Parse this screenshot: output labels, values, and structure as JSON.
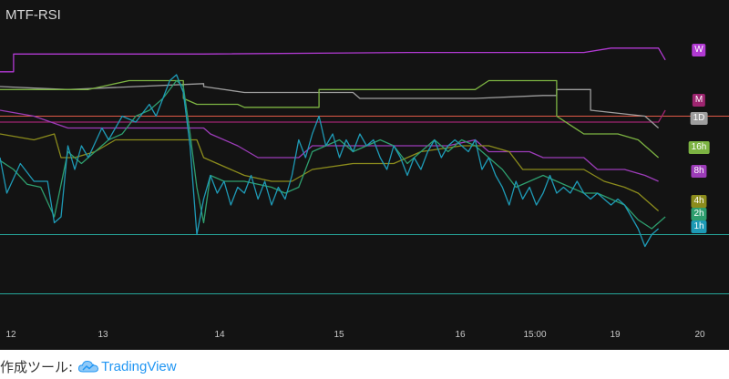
{
  "title": "MTF-RSI",
  "footer": {
    "prefix": "作成ツール:",
    "brand": "TradingView"
  },
  "colors": {
    "background": "#131313",
    "upper_line": "#e05a47",
    "lower_line": "#26a69a"
  },
  "chart_data": {
    "type": "line",
    "title": "MTF-RSI",
    "x_ticks": [
      "12",
      "13",
      "14",
      "15",
      "16",
      "15:00",
      "19",
      "20"
    ],
    "x_range": [
      0,
      100
    ],
    "y_range": [
      0,
      100
    ],
    "hlines": [
      {
        "value": 70,
        "color": "#e05a47"
      },
      {
        "value": 30,
        "color": "#26a69a"
      },
      {
        "value": 10,
        "color": "#26a69a"
      }
    ],
    "series": [
      {
        "name": "W",
        "color": "#b23ad3",
        "points": [
          [
            0,
            85
          ],
          [
            2,
            85
          ],
          [
            2,
            91
          ],
          [
            30,
            91
          ],
          [
            60,
            91.5
          ],
          [
            86,
            91.5
          ],
          [
            90,
            93
          ],
          [
            97,
            93
          ],
          [
            98,
            89
          ]
        ]
      },
      {
        "name": "M",
        "color": "#9e2570",
        "points": [
          [
            0,
            68
          ],
          [
            97,
            68
          ],
          [
            98,
            72
          ]
        ]
      },
      {
        "name": "1D",
        "color": "#9e9e9e",
        "points": [
          [
            0,
            80
          ],
          [
            10,
            79
          ],
          [
            20,
            80
          ],
          [
            30,
            81
          ],
          [
            30,
            80
          ],
          [
            36,
            78
          ],
          [
            48,
            78
          ],
          [
            52,
            78
          ],
          [
            53,
            76
          ],
          [
            70,
            76
          ],
          [
            80,
            77
          ],
          [
            82,
            77
          ],
          [
            82,
            79
          ],
          [
            87,
            79
          ],
          [
            87,
            72
          ],
          [
            95,
            70
          ],
          [
            97,
            66
          ]
        ]
      },
      {
        "name": "16h",
        "color": "#7cb342",
        "points": [
          [
            0,
            79
          ],
          [
            13,
            79
          ],
          [
            15,
            80
          ],
          [
            19,
            82
          ],
          [
            27,
            82
          ],
          [
            27,
            76
          ],
          [
            29,
            74
          ],
          [
            35,
            74
          ],
          [
            36,
            73
          ],
          [
            47,
            73
          ],
          [
            47,
            79
          ],
          [
            70,
            79
          ],
          [
            72,
            82
          ],
          [
            82,
            82
          ],
          [
            82,
            70
          ],
          [
            86,
            64
          ],
          [
            91,
            64
          ],
          [
            94,
            62
          ],
          [
            97,
            56
          ]
        ]
      },
      {
        "name": "8h",
        "color": "#9c3cb8",
        "points": [
          [
            0,
            72
          ],
          [
            5,
            70
          ],
          [
            10,
            66
          ],
          [
            19,
            66
          ],
          [
            25,
            66
          ],
          [
            30,
            66
          ],
          [
            31,
            64
          ],
          [
            35,
            60
          ],
          [
            38,
            56
          ],
          [
            44,
            56
          ],
          [
            46,
            60
          ],
          [
            55,
            60
          ],
          [
            60,
            60
          ],
          [
            66,
            60
          ],
          [
            70,
            62
          ],
          [
            72,
            58
          ],
          [
            78,
            58
          ],
          [
            80,
            56
          ],
          [
            86,
            56
          ],
          [
            88,
            52
          ],
          [
            92,
            52
          ],
          [
            95,
            50
          ],
          [
            97,
            48
          ]
        ]
      },
      {
        "name": "4h",
        "color": "#8c8c1c",
        "points": [
          [
            0,
            64
          ],
          [
            5,
            62
          ],
          [
            8,
            64
          ],
          [
            9,
            56
          ],
          [
            11,
            56
          ],
          [
            14,
            58
          ],
          [
            17,
            62
          ],
          [
            24,
            62
          ],
          [
            29,
            62
          ],
          [
            30,
            56
          ],
          [
            36,
            50
          ],
          [
            40,
            48
          ],
          [
            43,
            48
          ],
          [
            46,
            52
          ],
          [
            52,
            54
          ],
          [
            58,
            54
          ],
          [
            62,
            58
          ],
          [
            68,
            60
          ],
          [
            70,
            60
          ],
          [
            72,
            60
          ],
          [
            75,
            58
          ],
          [
            77,
            52
          ],
          [
            86,
            52
          ],
          [
            89,
            48
          ],
          [
            92,
            46
          ],
          [
            94,
            44
          ],
          [
            97,
            38
          ]
        ]
      },
      {
        "name": "2h",
        "color": "#2e9e6e",
        "points": [
          [
            0,
            55
          ],
          [
            2,
            52
          ],
          [
            4,
            47
          ],
          [
            6,
            46
          ],
          [
            8,
            36
          ],
          [
            10,
            58
          ],
          [
            12,
            54
          ],
          [
            14,
            58
          ],
          [
            16,
            62
          ],
          [
            18,
            64
          ],
          [
            20,
            70
          ],
          [
            22,
            72
          ],
          [
            24,
            76
          ],
          [
            26,
            82
          ],
          [
            27,
            80
          ],
          [
            28,
            64
          ],
          [
            29,
            46
          ],
          [
            30,
            34
          ],
          [
            31,
            50
          ],
          [
            33,
            48
          ],
          [
            36,
            48
          ],
          [
            38,
            47
          ],
          [
            40,
            46
          ],
          [
            42,
            44
          ],
          [
            44,
            46
          ],
          [
            45,
            52
          ],
          [
            46,
            58
          ],
          [
            48,
            60
          ],
          [
            50,
            62
          ],
          [
            52,
            58
          ],
          [
            54,
            60
          ],
          [
            56,
            62
          ],
          [
            58,
            60
          ],
          [
            60,
            54
          ],
          [
            62,
            58
          ],
          [
            64,
            62
          ],
          [
            66,
            58
          ],
          [
            68,
            62
          ],
          [
            70,
            60
          ],
          [
            72,
            56
          ],
          [
            74,
            52
          ],
          [
            76,
            46
          ],
          [
            78,
            48
          ],
          [
            80,
            50
          ],
          [
            82,
            48
          ],
          [
            84,
            46
          ],
          [
            86,
            44
          ],
          [
            88,
            44
          ],
          [
            90,
            42
          ],
          [
            92,
            40
          ],
          [
            94,
            35
          ],
          [
            96,
            32
          ],
          [
            98,
            36
          ]
        ]
      },
      {
        "name": "1h",
        "color": "#1e9ab6",
        "points": [
          [
            0,
            56
          ],
          [
            1,
            44
          ],
          [
            3,
            54
          ],
          [
            5,
            48
          ],
          [
            7,
            48
          ],
          [
            8,
            34
          ],
          [
            9,
            36
          ],
          [
            10,
            60
          ],
          [
            11,
            52
          ],
          [
            12,
            60
          ],
          [
            13,
            56
          ],
          [
            15,
            66
          ],
          [
            16,
            62
          ],
          [
            18,
            70
          ],
          [
            20,
            68
          ],
          [
            22,
            74
          ],
          [
            23,
            70
          ],
          [
            25,
            82
          ],
          [
            26,
            84
          ],
          [
            27,
            78
          ],
          [
            28,
            60
          ],
          [
            29,
            30
          ],
          [
            30,
            42
          ],
          [
            31,
            50
          ],
          [
            32,
            44
          ],
          [
            33,
            48
          ],
          [
            34,
            40
          ],
          [
            35,
            46
          ],
          [
            36,
            44
          ],
          [
            37,
            50
          ],
          [
            38,
            42
          ],
          [
            39,
            48
          ],
          [
            40,
            40
          ],
          [
            41,
            46
          ],
          [
            42,
            42
          ],
          [
            43,
            50
          ],
          [
            44,
            62
          ],
          [
            45,
            56
          ],
          [
            46,
            64
          ],
          [
            47,
            70
          ],
          [
            48,
            60
          ],
          [
            49,
            64
          ],
          [
            50,
            56
          ],
          [
            51,
            62
          ],
          [
            52,
            58
          ],
          [
            53,
            64
          ],
          [
            54,
            60
          ],
          [
            55,
            62
          ],
          [
            56,
            56
          ],
          [
            57,
            52
          ],
          [
            58,
            60
          ],
          [
            59,
            56
          ],
          [
            60,
            50
          ],
          [
            61,
            56
          ],
          [
            62,
            52
          ],
          [
            63,
            58
          ],
          [
            64,
            62
          ],
          [
            65,
            56
          ],
          [
            66,
            60
          ],
          [
            67,
            62
          ],
          [
            68,
            60
          ],
          [
            69,
            58
          ],
          [
            70,
            62
          ],
          [
            71,
            52
          ],
          [
            72,
            56
          ],
          [
            73,
            50
          ],
          [
            74,
            46
          ],
          [
            75,
            40
          ],
          [
            76,
            48
          ],
          [
            77,
            42
          ],
          [
            78,
            46
          ],
          [
            79,
            40
          ],
          [
            80,
            44
          ],
          [
            81,
            50
          ],
          [
            82,
            44
          ],
          [
            83,
            46
          ],
          [
            84,
            44
          ],
          [
            85,
            48
          ],
          [
            86,
            44
          ],
          [
            87,
            42
          ],
          [
            88,
            44
          ],
          [
            89,
            42
          ],
          [
            90,
            40
          ],
          [
            91,
            42
          ],
          [
            92,
            40
          ],
          [
            93,
            36
          ],
          [
            94,
            32
          ],
          [
            95,
            26
          ],
          [
            96,
            30
          ],
          [
            97,
            32
          ]
        ]
      }
    ],
    "legend": "right"
  }
}
